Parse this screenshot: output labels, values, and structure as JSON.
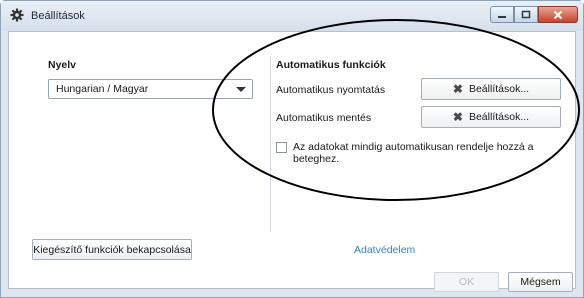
{
  "window": {
    "title": "Beállítások",
    "icon": "gear-icon"
  },
  "language": {
    "heading": "Nyelv",
    "selected": "Hungarian / Magyar"
  },
  "auto": {
    "heading": "Automatikus funkciók",
    "print_label": "Automatikus nyomtatás",
    "save_label": "Automatikus mentés",
    "settings_button": "Beállítások...",
    "checkbox_label": "Az adatokat mindig automatikusan rendelje hozzá a beteghez.",
    "checkbox_checked": false
  },
  "addons_button": "Kiegészítő funkciók bekapcsolása",
  "privacy_link": "Adatvédelem",
  "footer": {
    "ok": "OK",
    "cancel": "Mégsem"
  },
  "colors": {
    "link": "#3b7fc4",
    "close_button": "#c7432b"
  }
}
